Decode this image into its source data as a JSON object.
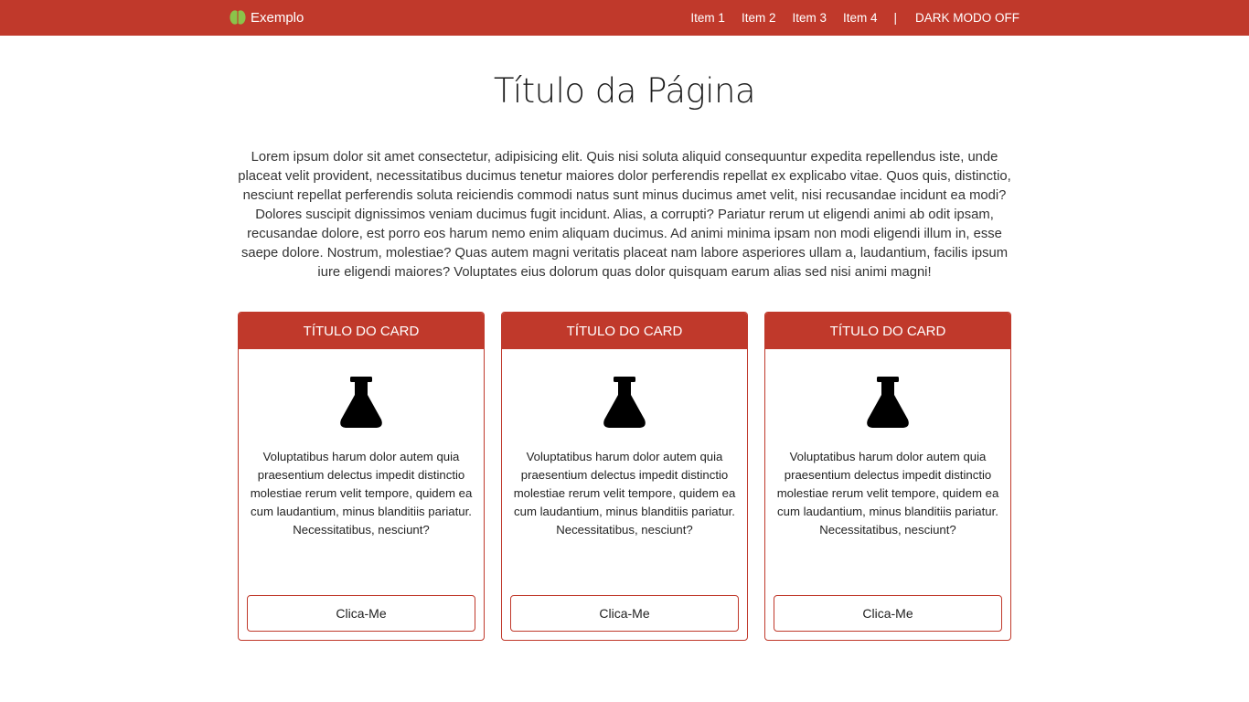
{
  "colors": {
    "primary": "#c0392b",
    "background": "#ffffff",
    "text": "#222222"
  },
  "navbar": {
    "brand_label": "Exemplo",
    "brand_icon": "brain-icon",
    "items": [
      {
        "label": "Item 1"
      },
      {
        "label": "Item 2"
      },
      {
        "label": "Item 3"
      },
      {
        "label": "Item 4"
      }
    ],
    "separator": "|",
    "dark_mode_label": "DARK MODO OFF"
  },
  "main": {
    "title": "Título da Página",
    "intro": "Lorem ipsum dolor sit amet consectetur, adipisicing elit. Quis nisi soluta aliquid consequuntur expedita repellendus iste, unde placeat velit provident, necessitatibus ducimus tenetur maiores dolor perferendis repellat ex explicabo vitae. Quos quis, distinctio, nesciunt repellat perferendis soluta reiciendis commodi natus sunt minus ducimus amet velit, nisi recusandae incidunt ea modi? Dolores suscipit dignissimos veniam ducimus fugit incidunt. Alias, a corrupti? Pariatur rerum ut eligendi animi ab odit ipsam, recusandae dolore, est porro eos harum nemo enim aliquam ducimus. Ad animi minima ipsam non modi eligendi illum in, esse saepe dolore. Nostrum, molestiae? Quas autem magni veritatis placeat nam labore asperiores ullam a, laudantium, facilis ipsum iure eligendi maiores? Voluptates eius dolorum quas dolor quisquam earum alias sed nisi animi magni!"
  },
  "cards": [
    {
      "title": "TÍTULO DO CARD",
      "icon": "flask-icon",
      "text": "Voluptatibus harum dolor autem quia praesentium delectus impedit distinctio molestiae rerum velit tempore, quidem ea cum laudantium, minus blanditiis pariatur. Necessitatibus, nesciunt?",
      "button_label": "Clica-Me"
    },
    {
      "title": "TÍTULO DO CARD",
      "icon": "flask-icon",
      "text": "Voluptatibus harum dolor autem quia praesentium delectus impedit distinctio molestiae rerum velit tempore, quidem ea cum laudantium, minus blanditiis pariatur. Necessitatibus, nesciunt?",
      "button_label": "Clica-Me"
    },
    {
      "title": "TÍTULO DO CARD",
      "icon": "flask-icon",
      "text": "Voluptatibus harum dolor autem quia praesentium delectus impedit distinctio molestiae rerum velit tempore, quidem ea cum laudantium, minus blanditiis pariatur. Necessitatibus, nesciunt?",
      "button_label": "Clica-Me"
    }
  ]
}
